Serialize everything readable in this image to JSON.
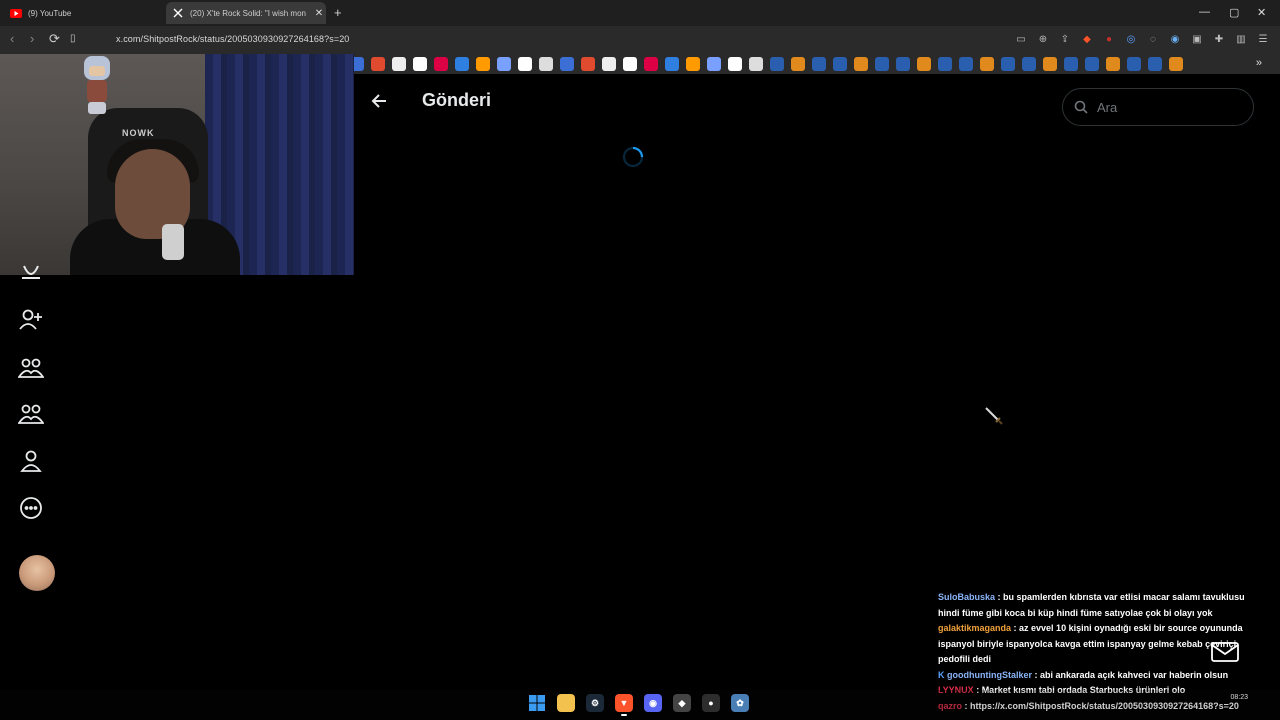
{
  "browser": {
    "tabs": [
      {
        "title": "(9) YouTube",
        "favicon": "youtube-icon",
        "active": false
      },
      {
        "title": "(20) X'te Rock Solid: \"I wish mon",
        "favicon": "x-icon",
        "active": true
      }
    ],
    "url": "x.com/ShitpostRock/status/2005030930927264168?s=20",
    "bookmark_count": 40
  },
  "page": {
    "title": "Gönderi",
    "search_placeholder": "Ara",
    "loading": true
  },
  "sidebar": {
    "items": [
      {
        "icon": "notifications-icon"
      },
      {
        "icon": "follow-icon"
      },
      {
        "icon": "communities-icon"
      },
      {
        "icon": "premium-icon"
      },
      {
        "icon": "profile-icon"
      },
      {
        "icon": "more-icon"
      }
    ]
  },
  "webcam": {
    "chair_logo": "NOWK"
  },
  "chat": {
    "messages": [
      {
        "user": "SuloBabuska",
        "color": "#8ab4f8",
        "text": "bu spamlerden kıbrısta var etlisi macar salamı tavuklusu hindi füme gibi koca bi küp hindi füme satıyolae çok bi olayı yok"
      },
      {
        "user": "galaktikmaganda",
        "color": "#f0a13a",
        "text": "az evvel 10 kişini oynadığı eski bir source oyununda ispanyol biriyle ispanyolca kavga ettim ispanyay gelme kebab çeviriçi pedofili dedi"
      },
      {
        "user": "goodhuntingStalker",
        "color": "#8ab4f8",
        "badge": "K",
        "text": "abi ankarada açık kahveci var haberin olsun"
      },
      {
        "user": "LYYNUX",
        "color": "#e0304a",
        "text": "Market kısmı tabi ordada Starbucks ürünleri olo"
      },
      {
        "user": "qazro",
        "color": "#e0304a",
        "text": "https://x.com/ShitpostRock/status/2005030930927264168?s=20"
      }
    ]
  },
  "taskbar": {
    "apps": [
      "windows-start-icon",
      "file-explorer-icon",
      "steam-icon",
      "brave-icon",
      "discord-icon",
      "app-icon",
      "obs-icon",
      "app2-icon"
    ],
    "time": "08:23"
  },
  "colors": {
    "background": "#000000",
    "text": "#e7e9ea",
    "muted": "#71767b",
    "accent": "#1d9bf0"
  }
}
